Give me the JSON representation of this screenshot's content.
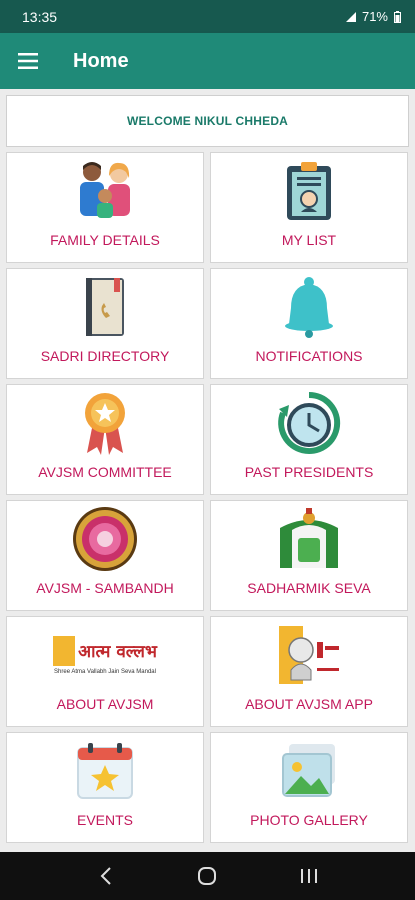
{
  "status_bar": {
    "time": "13:35",
    "battery": "71%"
  },
  "app_bar": {
    "title": "Home",
    "menu_icon": "hamburger-menu-icon"
  },
  "welcome": {
    "text": "WELCOME NIKUL CHHEDA"
  },
  "tiles": [
    {
      "label": "FAMILY DETAILS",
      "icon": "family-icon"
    },
    {
      "label": "MY LIST",
      "icon": "clipboard-icon"
    },
    {
      "label": "SADRI DIRECTORY",
      "icon": "phone-book-icon"
    },
    {
      "label": "NOTIFICATIONS",
      "icon": "bell-icon"
    },
    {
      "label": "AVJSM COMMITTEE",
      "icon": "award-ribbon-icon"
    },
    {
      "label": "PAST PRESIDENTS",
      "icon": "history-clock-icon"
    },
    {
      "label": "AVJSM - SAMBANDH",
      "icon": "sambandh-emblem-icon"
    },
    {
      "label": "SADHARMIK SEVA",
      "icon": "sadharmik-seva-emblem-icon"
    },
    {
      "label": "ABOUT AVJSM",
      "icon": "atma-vallabh-logo-icon"
    },
    {
      "label": "ABOUT AVJSM APP",
      "icon": "app-info-portrait-icon"
    },
    {
      "label": "EVENTS",
      "icon": "calendar-star-icon"
    },
    {
      "label": "PHOTO GALLERY",
      "icon": "photo-gallery-icon"
    }
  ],
  "logo_text": {
    "atma": "आत्म वल्लभ",
    "mandal": "Shree Atma Vallabh Jain Seva Mandal"
  },
  "nav_bar": {
    "back": "back-icon",
    "home": "home-icon",
    "recents": "recents-icon"
  },
  "colors": {
    "status_bar": "#17594f",
    "app_bar": "#1f8a78",
    "label": "#c2185b",
    "welcome": "#1a7a69"
  }
}
